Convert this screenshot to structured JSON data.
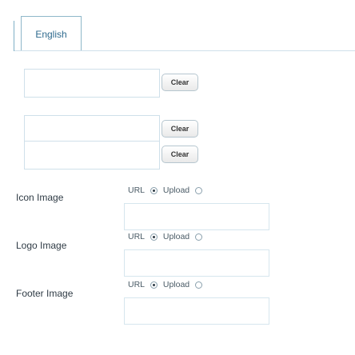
{
  "tabs": [
    {
      "label": "English"
    }
  ],
  "text_rows": [
    {
      "clear_label": "Clear"
    },
    {
      "clear_label": "Clear"
    },
    {
      "clear_label": "Clear"
    }
  ],
  "image_settings": [
    {
      "label": "Icon Image",
      "option_url": "URL",
      "option_upload": "Upload",
      "selected": "URL"
    },
    {
      "label": "Logo Image",
      "option_url": "URL",
      "option_upload": "Upload",
      "selected": "URL"
    },
    {
      "label": "Footer Image",
      "option_url": "URL",
      "option_upload": "Upload",
      "selected": "URL"
    }
  ]
}
